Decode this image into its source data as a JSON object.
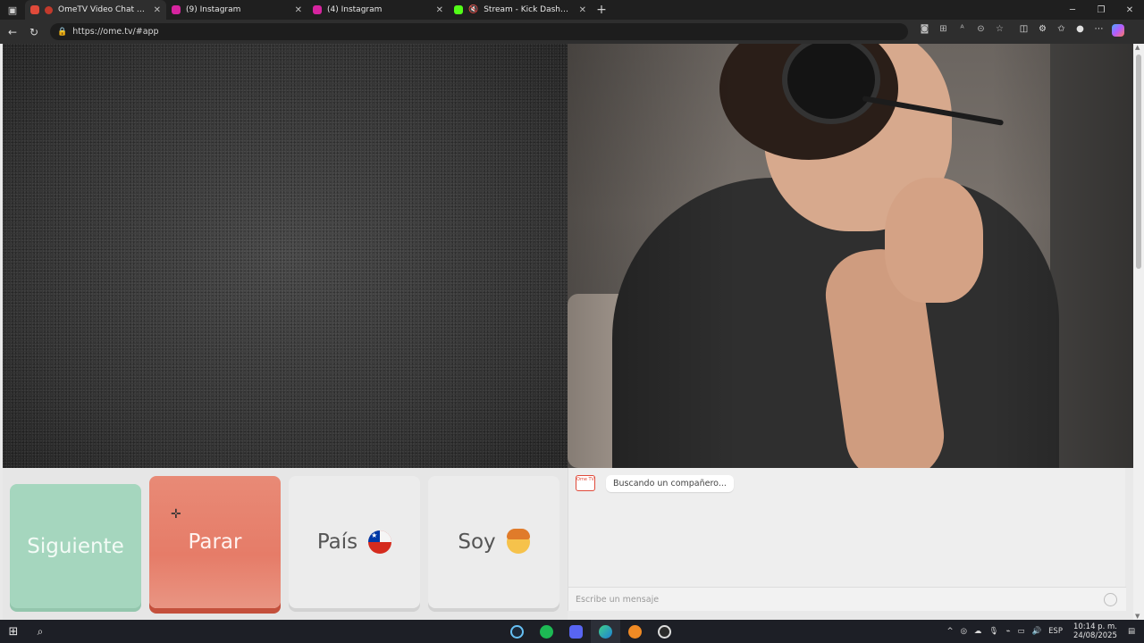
{
  "browser": {
    "tabs": [
      {
        "title": "OmeTV Video Chat — Ome...",
        "active": true,
        "favicon_color": "#e04a3a"
      },
      {
        "title": "(9) Instagram",
        "active": false,
        "favicon_color": "#d6249f"
      },
      {
        "title": "(4) Instagram",
        "active": false,
        "favicon_color": "#d6249f"
      },
      {
        "title": "Stream - Kick Dashboard",
        "active": false,
        "favicon_color": "#53fc18"
      }
    ],
    "url": "https://ome.tv/#app"
  },
  "controls": {
    "next_label": "Siguiente",
    "stop_label": "Parar",
    "country_label": "País",
    "gender_label": "Soy"
  },
  "chat": {
    "status_message": "Buscando un compañero...",
    "input_placeholder": "Escribe un mensaje",
    "logo_text": "Ome TV"
  },
  "taskbar": {
    "language": "ESP",
    "time": "10:14 p. m.",
    "date": "24/08/2025"
  },
  "colors": {
    "next_button": "#a5d6be",
    "stop_button": "#e67c68",
    "neutral_button": "#ececec"
  }
}
